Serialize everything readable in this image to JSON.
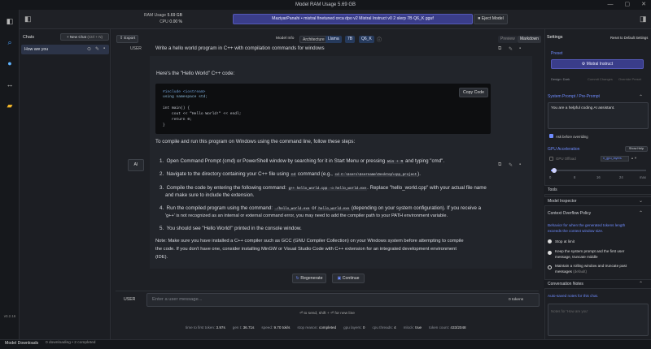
{
  "window": {
    "title_prefix": "Model RAM Usage",
    "title_value": "5.69 GB",
    "controls": [
      "—",
      "▢",
      "✕"
    ]
  },
  "header": {
    "ram_label": "RAM Usage",
    "ram_value": "5.69 GB",
    "cpu_label": "CPU",
    "cpu_value": "0.00 %",
    "model_name": "MaziyarPanahi • mistral finetuned orca dpo v2 Mistral Instruct v0 2 slerp 7B Q6_K gguf",
    "eject_label": "Eject Model"
  },
  "chats": {
    "title": "Chats",
    "new_chat": "+ New Chat",
    "new_chat_shortcut": "(Ctrl + N)",
    "items": [
      "How are you"
    ]
  },
  "toolbar": {
    "export": "Export",
    "model_info": "Model Info",
    "arch_label": "Architecture",
    "arch_value": "Llama",
    "params": "7B",
    "quant": "Q6_K",
    "preview": "Preview",
    "markdown": "Markdown"
  },
  "conversation": {
    "user_role": "USER",
    "user_message": "Write a hello world program in C++ with compilation commands for windows",
    "ai_role": "AI",
    "intro": "Here's the \"Hello World\" C++ code:",
    "code_lines": [
      "#include <iostream>",
      "using namespace std;",
      "",
      "int main() {",
      "    cout << \"Hello World!\" << endl;",
      "    return 0;",
      "}"
    ],
    "copy_code": "Copy Code",
    "steps_intro": "To compile and run this program on Windows using the command line, follow these steps:",
    "step1": "Open Command Prompt (cmd) or PowerShell window by searching for it in Start Menu or pressing",
    "step1_code": "Win + R",
    "step1_end": "and typing \"cmd\".",
    "step2": "Navigate to the directory containing your C++ file using",
    "step2_code1": "cd",
    "step2_mid": "command (e.g.,",
    "step2_code2": "cd C:\\Users\\Username\\Desktop\\cpp_project",
    "step2_end": ").",
    "step3": "Compile the code by entering the following command:",
    "step3_code": "g++ hello_world.cpp -o hello_world.exe",
    "step3_end": ". Replace \"hello_world.cpp\" with your actual file name",
    "step3_line2": "and make sure to include the extension.",
    "step4": "Run the compiled program using the command:",
    "step4_code1": "./hello_world.exe",
    "step4_or": "or",
    "step4_code2": "hello_world.exe",
    "step4_end": "(depending on your system configuration). If you receive a",
    "step4_line2": "'g++' is not recognized as an internal or external command error, you may need to add the compiler path to your PATH environment variable.",
    "step5": "You should see \"Hello World!\" printed in the console window.",
    "note_line1": "Note: Make sure you have installed a C++ compiler such as GCC (GNU Compiler Collection) on your Windows system before attempting to compile",
    "note_line2": "the code. If you don't have one, consider installing MinGW or Visual Studio Code with C++ extension for an integrated development environment",
    "note_line3": "(IDE).",
    "regenerate": "Regenerate",
    "continue": "Continue"
  },
  "input": {
    "role": "USER",
    "placeholder": "Enter a user message...",
    "tokens": "0 tokens",
    "hint": "⏎ to send, shift + ⏎ for new line"
  },
  "stats": [
    {
      "label": "time to first token:",
      "value": "3.97s"
    },
    {
      "label": "gen t:",
      "value": "36.71s"
    },
    {
      "label": "speed:",
      "value": "9.70 tok/s"
    },
    {
      "label": "stop reason:",
      "value": "completed"
    },
    {
      "label": "gpu layers:",
      "value": "0"
    },
    {
      "label": "cpu threads:",
      "value": "4"
    },
    {
      "label": "mlock:",
      "value": "true"
    },
    {
      "label": "token count:",
      "value": "433/2048"
    }
  ],
  "settings": {
    "title": "Settings",
    "reset": "Reset to Default Settings",
    "preset_label": "Preset",
    "preset_value": "Mistral Instruct",
    "design_label": "Design: Dark",
    "unsaved": "Commit Changes",
    "override": "Override Preset",
    "system_prompt_label": "System Prompt / Pre-Prompt",
    "system_prompt": "You are a helpful coding AI assistant.",
    "ask_override": "Ask before overriding",
    "gpu_label": "GPU Acceleration",
    "show_help": "Show Help",
    "gpu_offload": "GPU Offload",
    "gpu_layers_placeholder": "n_gpu_layers",
    "slider_ticks": [
      "0",
      "8",
      "16",
      "24",
      "max"
    ],
    "slider_value_fraction": 0.03,
    "tools": "Tools",
    "model_inspector": "Model Inspector",
    "context_policy": "Context Overflow Policy",
    "context_desc1": "Behavior for when the generated tokens length",
    "context_desc2": "exceeds the context window size.",
    "opt1": "Stop at limit",
    "opt2_l1": "Keep the system prompt and the first user",
    "opt2_l2": "message, truncate middle",
    "opt3_l1": "Maintain a rolling window and truncate past",
    "opt3_l2": "messages",
    "opt3_default": "(default)",
    "conv_notes": "Conversation Notes",
    "notes_desc": "Auto-saved notes for this chat.",
    "notes_placeholder": "Notes for 'How are you'"
  },
  "footer": {
    "version": "v0.2.16",
    "downloads_label": "Model Downloads",
    "downloads_status": "0 downloading • 2 completed"
  },
  "colors": {
    "accent": "#3a3d8a",
    "link": "#6f8cff"
  }
}
